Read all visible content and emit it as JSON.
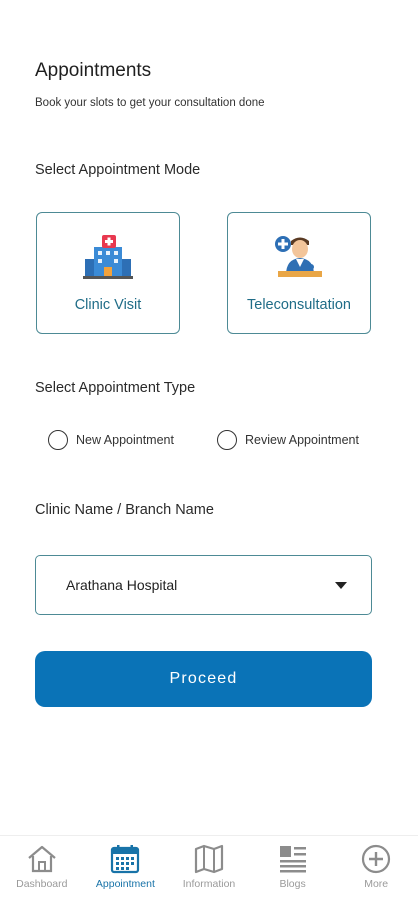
{
  "header": {
    "title": "Appointments",
    "subtitle": "Book your slots to get your consultation done"
  },
  "mode_section": {
    "label": "Select Appointment Mode",
    "options": [
      {
        "label": "Clinic Visit",
        "icon": "hospital-icon"
      },
      {
        "label": "Teleconsultation",
        "icon": "doctor-icon"
      }
    ]
  },
  "type_section": {
    "label": "Select Appointment Type",
    "options": [
      {
        "label": "New Appointment",
        "selected": false
      },
      {
        "label": "Review Appointment",
        "selected": false
      }
    ]
  },
  "clinic_section": {
    "label": "Clinic Name / Branch Name",
    "selected_value": "Arathana Hospital"
  },
  "proceed_label": "Proceed",
  "bottom_nav": {
    "items": [
      {
        "label": "Dashboard",
        "icon": "home-icon",
        "active": false
      },
      {
        "label": "Appointment",
        "icon": "calendar-icon",
        "active": true
      },
      {
        "label": "Information",
        "icon": "map-icon",
        "active": false
      },
      {
        "label": "Blogs",
        "icon": "news-icon",
        "active": false
      },
      {
        "label": "More",
        "icon": "plus-circle-icon",
        "active": false
      }
    ]
  },
  "colors": {
    "accent_blue": "#0a73b7",
    "card_border": "#4d8a95",
    "card_text": "#1f6c87",
    "nav_active": "#1873a8",
    "nav_inactive": "#9a9a9a"
  }
}
